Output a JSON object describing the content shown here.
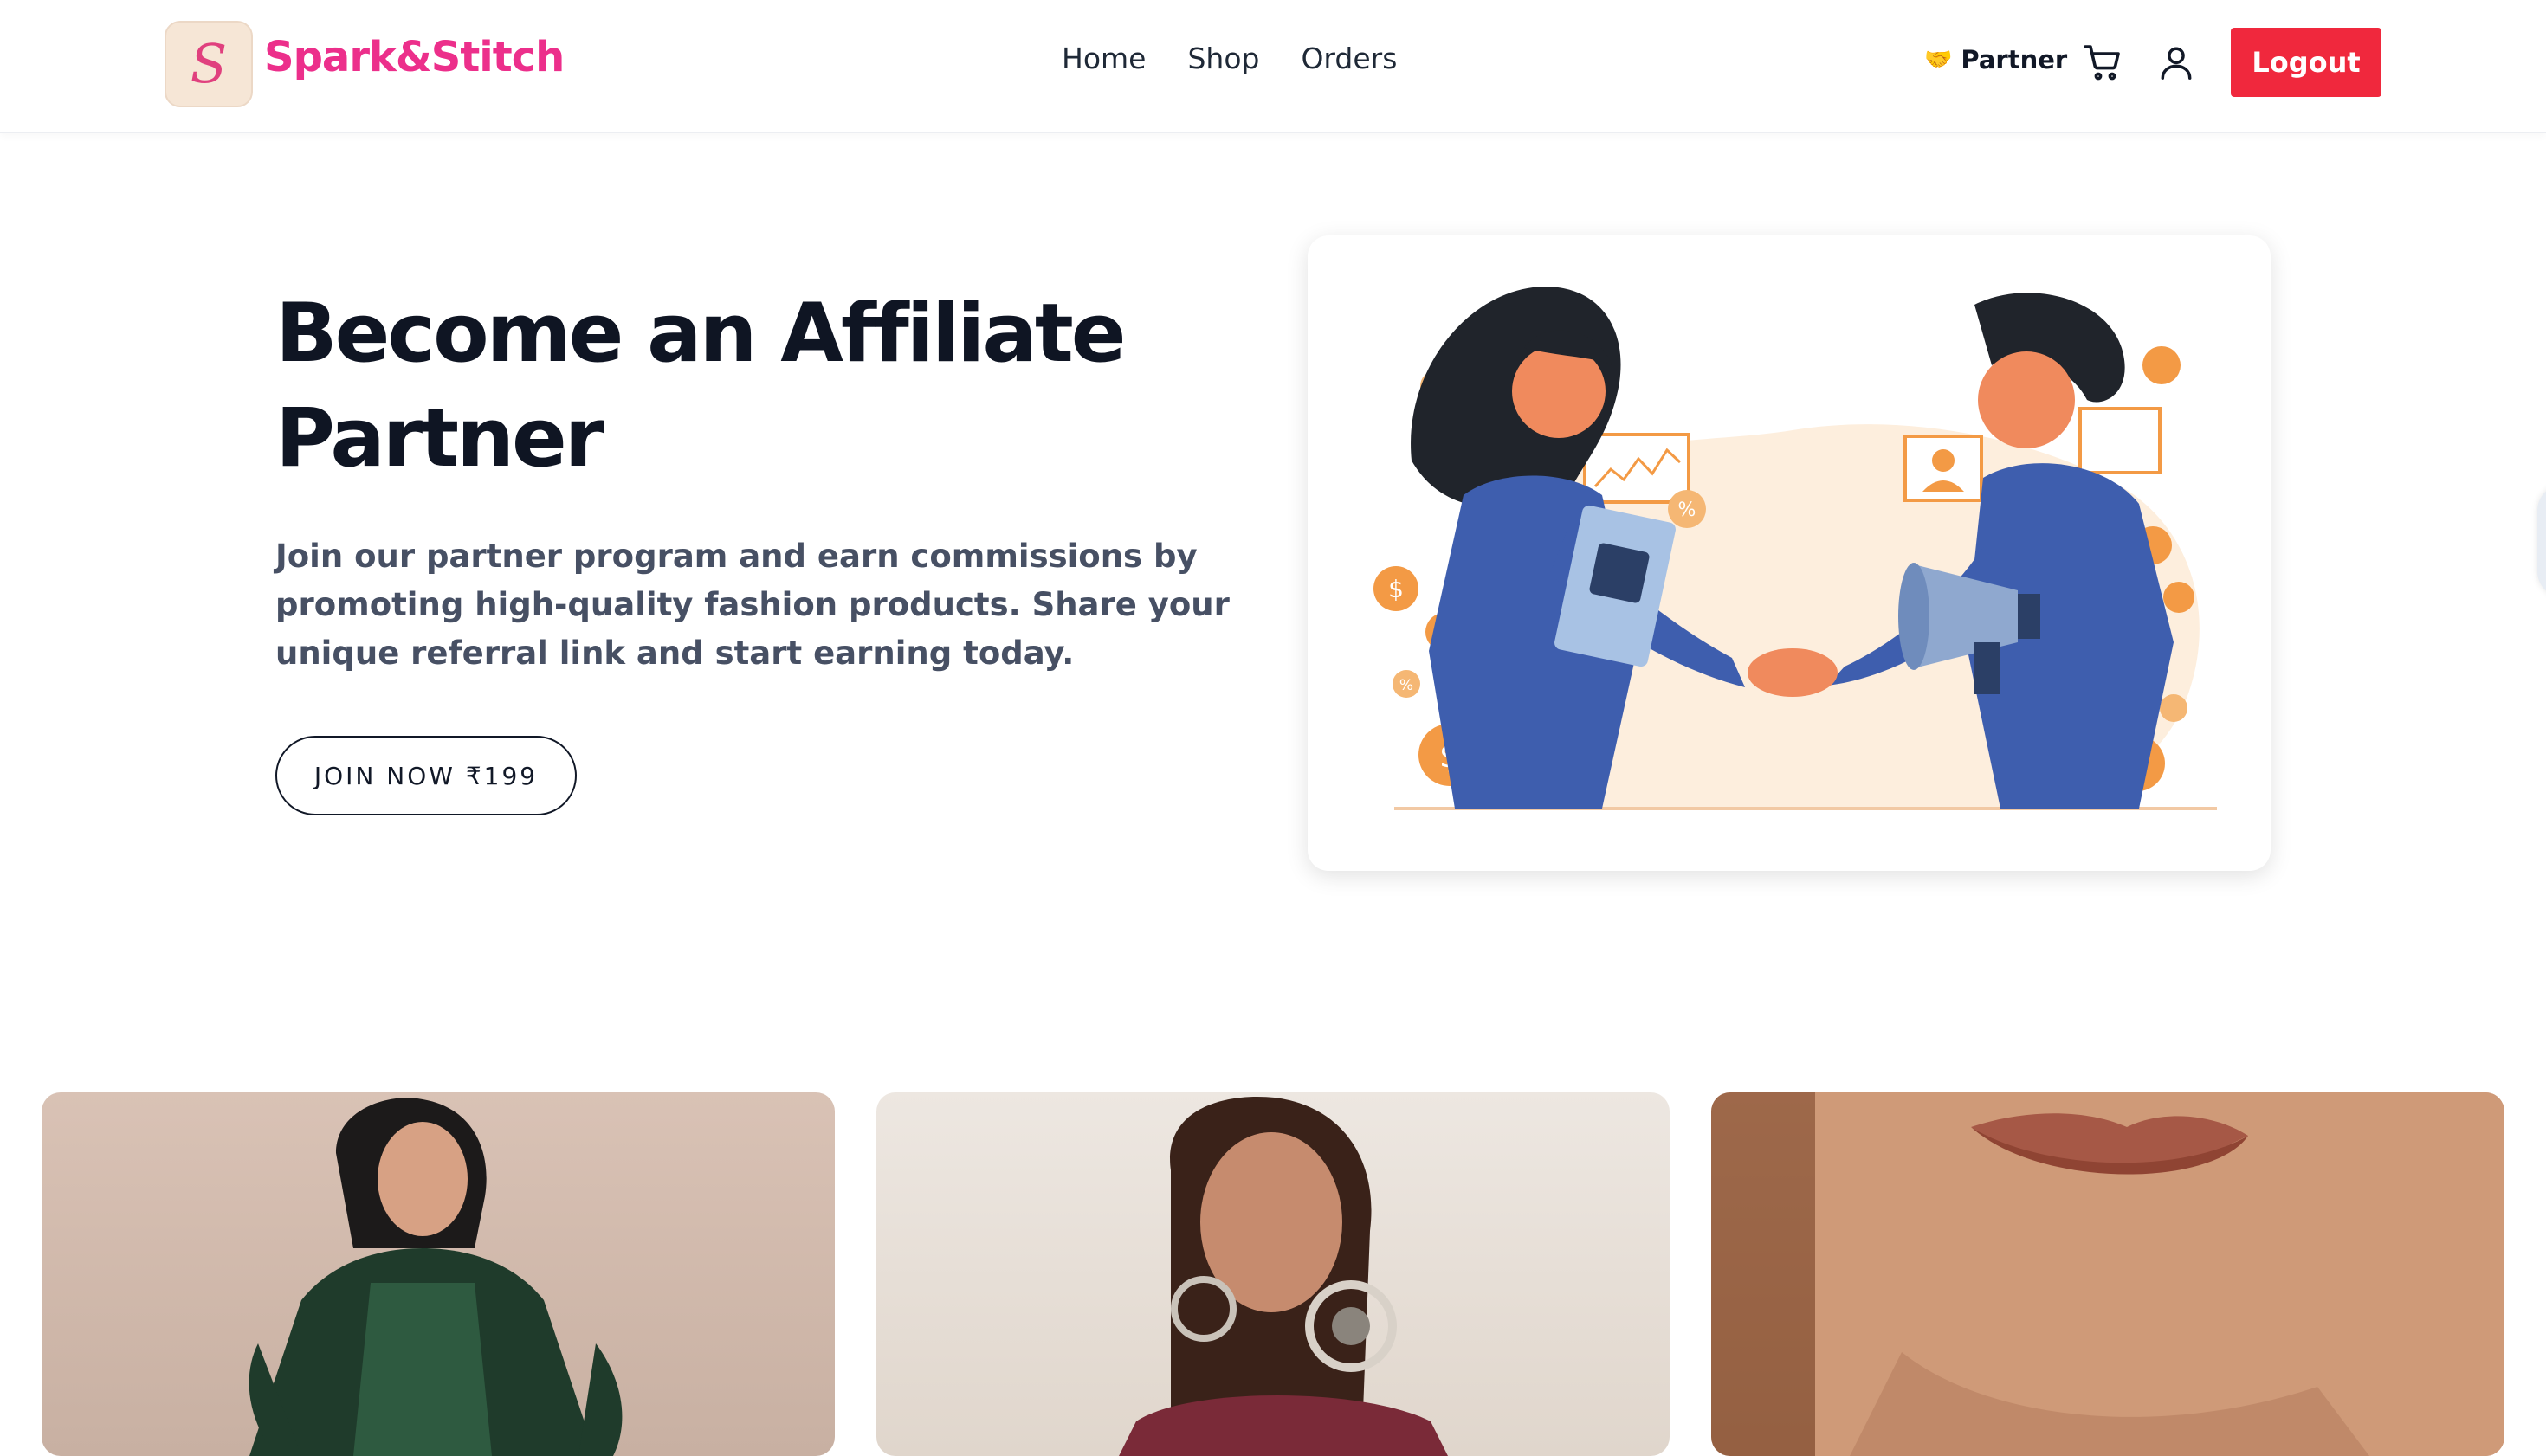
{
  "header": {
    "logo_glyph": "S",
    "brand": "Spark&Stitch",
    "nav": [
      "Home",
      "Shop",
      "Orders"
    ],
    "partner_label": "Partner",
    "partner_icon": "handshake-icon",
    "cart_icon": "cart-icon",
    "user_icon": "user-icon",
    "logout_label": "Logout",
    "colors": {
      "brand": "#ec2f8b",
      "logout": "#f0283d"
    }
  },
  "hero": {
    "title": "Become an Affiliate Partner",
    "description": "Join our partner program and earn commissions by promoting high-quality fashion products. Share your unique referral link and start earning today.",
    "cta_label": "JOIN NOW ₹199"
  },
  "products": [
    {
      "name": "green-kurta-model-image"
    },
    {
      "name": "earrings-model-image"
    },
    {
      "name": "lipstick-closeup-image"
    }
  ]
}
